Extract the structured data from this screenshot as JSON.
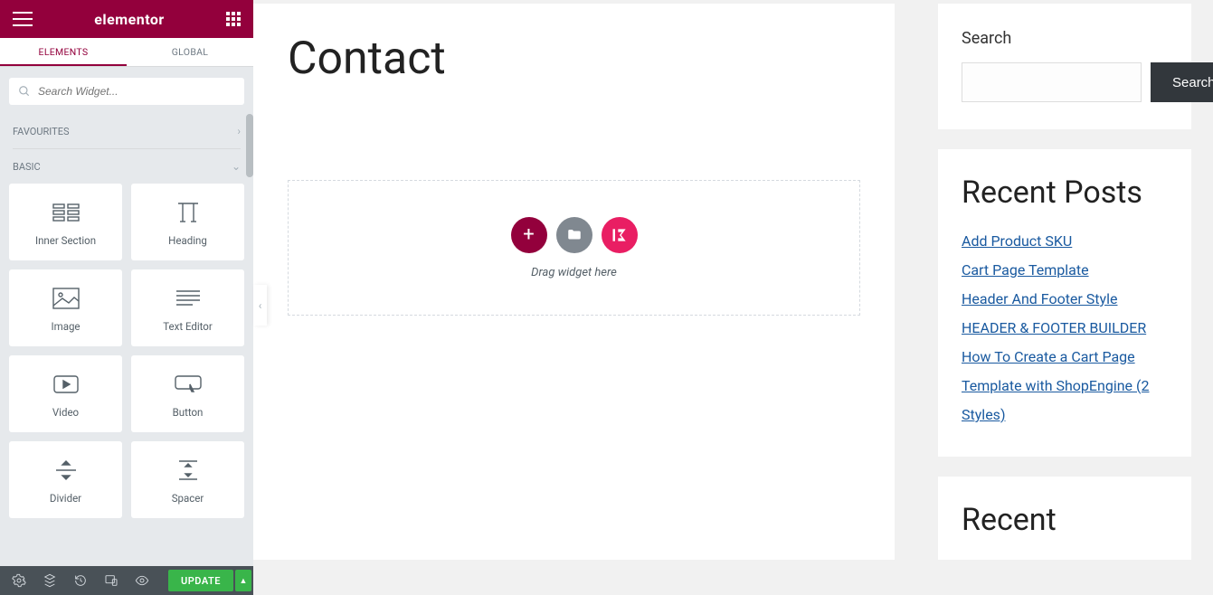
{
  "header": {
    "brand": "elementor"
  },
  "tabs": {
    "elements": "ELEMENTS",
    "global": "GLOBAL"
  },
  "search": {
    "placeholder": "Search Widget..."
  },
  "categories": {
    "favourites": "FAVOURITES",
    "basic": "BASIC"
  },
  "widgets": {
    "inner_section": "Inner Section",
    "heading": "Heading",
    "image": "Image",
    "text_editor": "Text Editor",
    "video": "Video",
    "button": "Button",
    "divider": "Divider",
    "spacer": "Spacer"
  },
  "footer": {
    "update": "UPDATE"
  },
  "page": {
    "title": "Contact",
    "drop_hint": "Drag widget here"
  },
  "sidebar_widgets": {
    "search": {
      "title": "Search",
      "button": "Search"
    },
    "recent_posts": {
      "title": "Recent Posts",
      "items": [
        "Add Product SKU",
        "Cart Page Template",
        "Header And Footer Style",
        "HEADER & FOOTER BUILDER",
        "How To Create a Cart Page Template with ShopEngine (2 Styles)"
      ]
    },
    "recent": {
      "title": "Recent"
    }
  }
}
